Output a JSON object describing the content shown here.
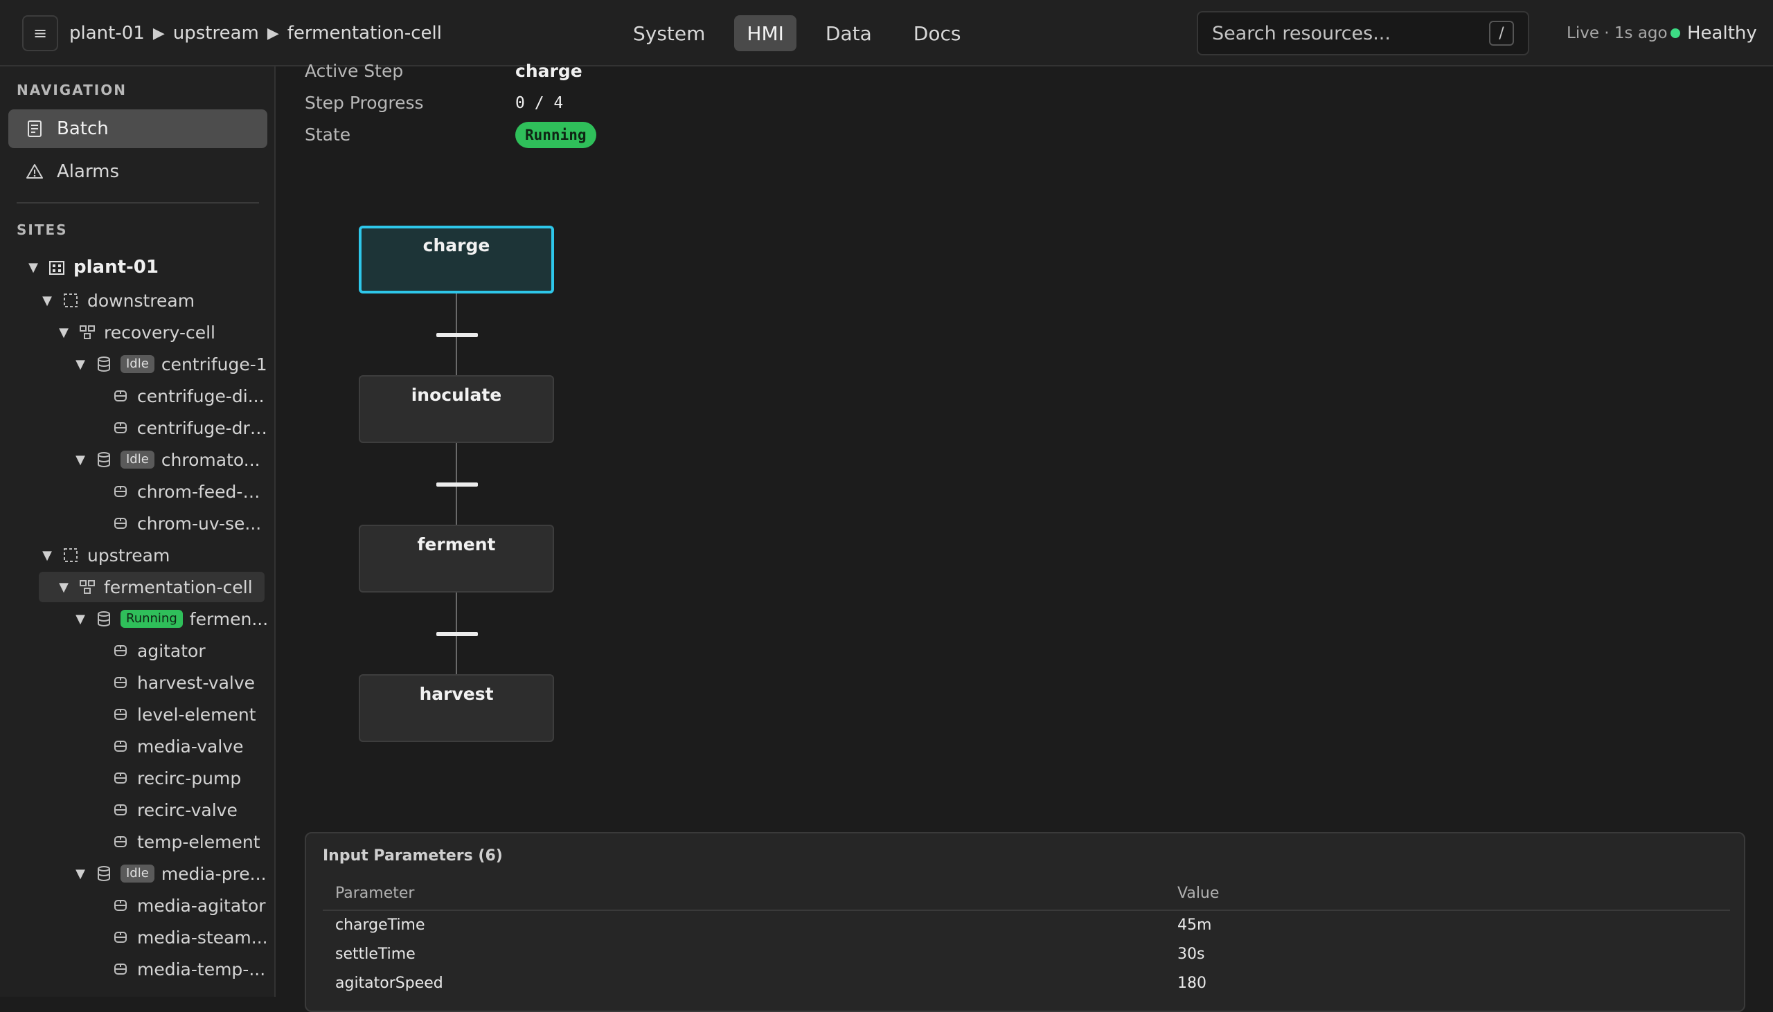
{
  "header": {
    "menu_glyph": "≡",
    "breadcrumb": [
      "plant-01",
      "upstream",
      "fermentation-cell"
    ],
    "breadcrumb_sep": "▶",
    "tabs": [
      {
        "label": "System",
        "active": false
      },
      {
        "label": "HMI",
        "active": true
      },
      {
        "label": "Data",
        "active": false
      },
      {
        "label": "Docs",
        "active": false
      }
    ],
    "search_placeholder": "Search resources...",
    "search_shortcut": "/",
    "live_status": "Live · 1s ago",
    "health_label": "Healthy",
    "health_color": "#3ddc84"
  },
  "sidebar": {
    "nav_heading": "NAVIGATION",
    "nav_items": [
      {
        "label": "Batch",
        "icon": "document-icon",
        "active": true
      },
      {
        "label": "Alarms",
        "icon": "warning-icon",
        "active": false
      }
    ],
    "sites_heading": "SITES",
    "tree": [
      {
        "label": "plant-01",
        "level": 0,
        "icon": "building-icon",
        "expanded": true
      },
      {
        "label": "downstream",
        "level": 1,
        "icon": "area-icon",
        "expanded": true
      },
      {
        "label": "recovery-cell",
        "level": 2,
        "icon": "cell-icon",
        "expanded": true
      },
      {
        "label": "centrifuge-1",
        "level": 3,
        "icon": "unit-icon",
        "expanded": true,
        "badge": "Idle"
      },
      {
        "label": "centrifuge-di...",
        "level": 4,
        "icon": "equipment-icon"
      },
      {
        "label": "centrifuge-dri...",
        "level": 4,
        "icon": "equipment-icon"
      },
      {
        "label": "chromato...",
        "level": 3,
        "icon": "unit-icon",
        "expanded": true,
        "badge": "Idle"
      },
      {
        "label": "chrom-feed-p...",
        "level": 4,
        "icon": "equipment-icon"
      },
      {
        "label": "chrom-uv-se...",
        "level": 4,
        "icon": "equipment-icon"
      },
      {
        "label": "upstream",
        "level": 1,
        "icon": "area-icon",
        "expanded": true
      },
      {
        "label": "fermentation-cell",
        "level": 2,
        "icon": "cell-icon",
        "expanded": true,
        "selected": true
      },
      {
        "label": "fermen...",
        "level": 3,
        "icon": "unit-icon",
        "expanded": true,
        "badge": "Running"
      },
      {
        "label": "agitator",
        "level": 4,
        "icon": "equipment-icon"
      },
      {
        "label": "harvest-valve",
        "level": 4,
        "icon": "equipment-icon"
      },
      {
        "label": "level-element",
        "level": 4,
        "icon": "equipment-icon"
      },
      {
        "label": "media-valve",
        "level": 4,
        "icon": "equipment-icon"
      },
      {
        "label": "recirc-pump",
        "level": 4,
        "icon": "equipment-icon"
      },
      {
        "label": "recirc-valve",
        "level": 4,
        "icon": "equipment-icon"
      },
      {
        "label": "temp-element",
        "level": 4,
        "icon": "equipment-icon"
      },
      {
        "label": "media-pre...",
        "level": 3,
        "icon": "unit-icon",
        "expanded": true,
        "badge": "Idle"
      },
      {
        "label": "media-agitator",
        "level": 4,
        "icon": "equipment-icon"
      },
      {
        "label": "media-steam...",
        "level": 4,
        "icon": "equipment-icon"
      },
      {
        "label": "media-temp-...",
        "level": 4,
        "icon": "equipment-icon"
      }
    ]
  },
  "batch": {
    "active_step_label": "Active Step",
    "active_step_value": "charge",
    "step_progress_label": "Step Progress",
    "step_progress_value": "0 / 4",
    "state_label": "State",
    "state_value": "Running",
    "state_color": "#2fbf5a",
    "steps": [
      {
        "label": "charge",
        "active": true
      },
      {
        "label": "inoculate",
        "active": false
      },
      {
        "label": "ferment",
        "active": false
      },
      {
        "label": "harvest",
        "active": false
      }
    ],
    "active_color": "#2ec7ea"
  },
  "params": {
    "title": "Input Parameters (6)",
    "columns": [
      "Parameter",
      "Value"
    ],
    "rows": [
      [
        "chargeTime",
        "45m"
      ],
      [
        "settleTime",
        "30s"
      ],
      [
        "agitatorSpeed",
        "180"
      ]
    ]
  }
}
